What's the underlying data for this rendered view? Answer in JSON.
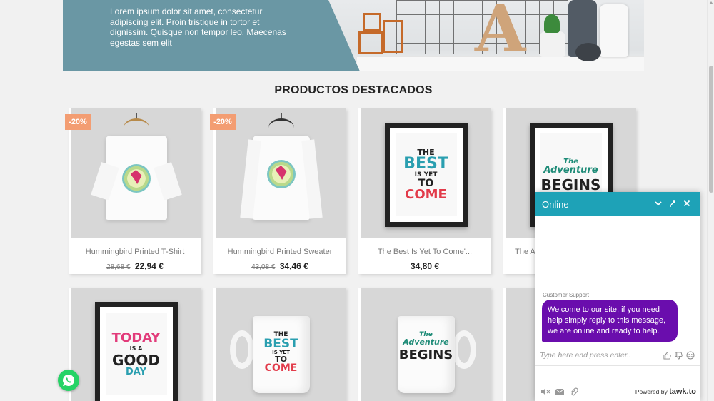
{
  "hero": {
    "text": "Lorem ipsum dolor sit amet, consectetur adipiscing elit. Proin tristique in tortor et dignissim. Quisque non tempor leo. Maecenas egestas sem elit"
  },
  "section": {
    "title": "PRODUCTOS DESTACADOS"
  },
  "products": [
    {
      "name": "Hummingbird Printed T-Shirt",
      "old_price": "28,68 €",
      "price": "22,94 €",
      "discount": "-20%"
    },
    {
      "name": "Hummingbird Printed Sweater",
      "old_price": "43,08 €",
      "price": "34,46 €",
      "discount": "-20%"
    },
    {
      "name": "The Best Is Yet To Come'...",
      "price": "34,80 €"
    },
    {
      "name": "The A"
    }
  ],
  "posters": {
    "best": {
      "l1": "THE",
      "l2": "BEST",
      "l3": "IS YET",
      "l4": "TO",
      "l5": "COME"
    },
    "adventure": {
      "l1": "The",
      "l2": "Adventure",
      "l3": "BEGINS"
    },
    "today": {
      "l1": "TODAY",
      "l2": "IS A",
      "l3": "GOOD",
      "l4": "DAY"
    }
  },
  "chat": {
    "status": "Online",
    "agent": "Customer Support",
    "message": "Welcome to our site, if you need help simply reply to this message, we are online and ready to help.",
    "input_placeholder": "Type here and press enter..",
    "powered_prefix": "Powered by",
    "powered_brand": "tawk.to"
  },
  "colors": {
    "hero_bg": "#6a97a4",
    "badge": "#f39d72",
    "chat_header": "#1ea2b7",
    "chat_bubble": "#6a0dad",
    "whatsapp": "#25d366"
  }
}
